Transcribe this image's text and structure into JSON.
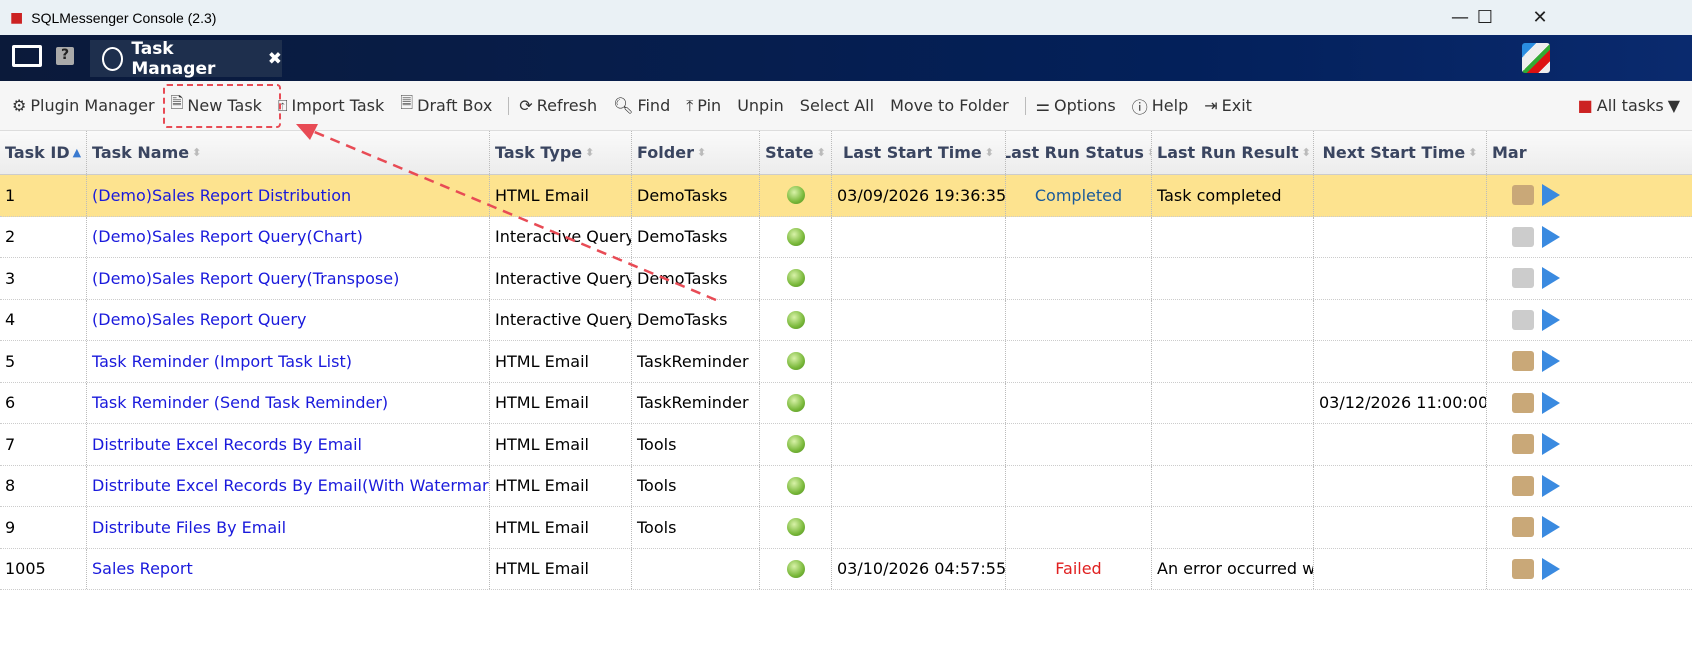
{
  "window": {
    "title": "SQLMessenger Console (2.3)"
  },
  "nav": {
    "tab_label": "Task Manager"
  },
  "toolbar": {
    "items": [
      "Plugin Manager",
      "New Task",
      "Import Task",
      "Draft Box",
      "Refresh",
      "Find",
      "Pin",
      "Unpin",
      "Select All",
      "Move to Folder",
      "Options",
      "Help",
      "Exit"
    ],
    "filter": "All tasks"
  },
  "columns": [
    "Task ID",
    "Task Name",
    "Task Type",
    "Folder",
    "State",
    "Last Start Time",
    "Last Run Status",
    "Last Run Result",
    "Next Start Time",
    "Mar"
  ],
  "rows": [
    {
      "id": "1",
      "name": "(Demo)Sales Report Distribution",
      "type": "HTML Email",
      "folder": "DemoTasks",
      "last_start": "03/09/2026 19:36:35",
      "status": "Completed",
      "result": "Task completed",
      "next": "",
      "selected": true
    },
    {
      "id": "2",
      "name": "(Demo)Sales Report Query(Chart)",
      "type": "Interactive Query",
      "folder": "DemoTasks",
      "last_start": "",
      "status": "",
      "result": "",
      "next": ""
    },
    {
      "id": "3",
      "name": "(Demo)Sales Report Query(Transpose)",
      "type": "Interactive Query",
      "folder": "DemoTasks",
      "last_start": "",
      "status": "",
      "result": "",
      "next": ""
    },
    {
      "id": "4",
      "name": "(Demo)Sales Report Query",
      "type": "Interactive Query",
      "folder": "DemoTasks",
      "last_start": "",
      "status": "",
      "result": "",
      "next": ""
    },
    {
      "id": "5",
      "name": "Task Reminder (Import Task List)",
      "type": "HTML Email",
      "folder": "TaskReminder",
      "last_start": "",
      "status": "",
      "result": "",
      "next": ""
    },
    {
      "id": "6",
      "name": "Task Reminder (Send Task Reminder)",
      "type": "HTML Email",
      "folder": "TaskReminder",
      "last_start": "",
      "status": "",
      "result": "",
      "next": "03/12/2026 11:00:00"
    },
    {
      "id": "7",
      "name": "Distribute Excel Records By Email",
      "type": "HTML Email",
      "folder": "Tools",
      "last_start": "",
      "status": "",
      "result": "",
      "next": ""
    },
    {
      "id": "8",
      "name": "Distribute Excel Records By Email(With Watermark)",
      "type": "HTML Email",
      "folder": "Tools",
      "last_start": "",
      "status": "",
      "result": "",
      "next": ""
    },
    {
      "id": "9",
      "name": "Distribute Files By Email",
      "type": "HTML Email",
      "folder": "Tools",
      "last_start": "",
      "status": "",
      "result": "",
      "next": ""
    },
    {
      "id": "1005",
      "name": "Sales Report",
      "type": "HTML Email",
      "folder": "",
      "last_start": "03/10/2026 04:57:55",
      "status": "Failed",
      "result": "An error occurred w",
      "next": ""
    }
  ],
  "colors": {
    "completed": "#1a5a9a",
    "failed": "#e02020",
    "selected_row": "#fde38f",
    "link": "#1a1adc",
    "annotation": "#e84b55"
  }
}
